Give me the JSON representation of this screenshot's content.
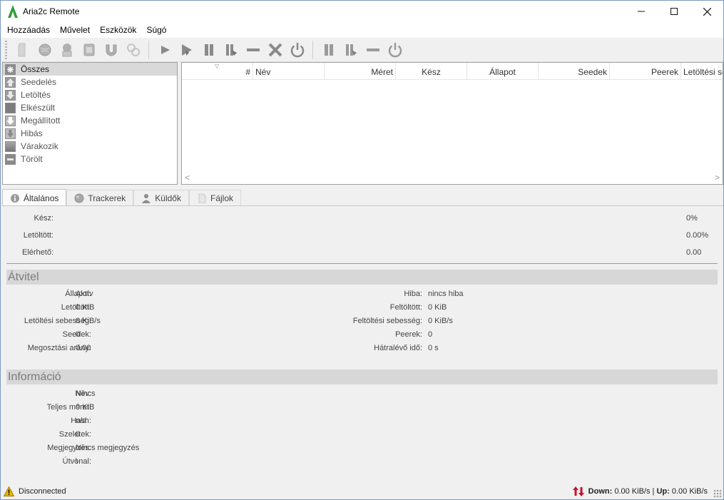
{
  "window": {
    "title": "Aria2c Remote"
  },
  "menu": [
    "Hozzáadás",
    "Művelet",
    "Eszközök",
    "Súgó"
  ],
  "filters": [
    {
      "label": "Összes",
      "icon": "asterisk-icon",
      "active": true
    },
    {
      "label": "Seedelés",
      "icon": "upload-arrow-icon"
    },
    {
      "label": "Letöltés",
      "icon": "download-arrow-icon"
    },
    {
      "label": "Elkészült",
      "icon": "completed-icon"
    },
    {
      "label": "Megállított",
      "icon": "stopped-icon"
    },
    {
      "label": "Hibás",
      "icon": "error-icon"
    },
    {
      "label": "Várakozik",
      "icon": "waiting-icon"
    },
    {
      "label": "Törölt",
      "icon": "removed-icon"
    }
  ],
  "table": {
    "columns": [
      "#",
      "Név",
      "Méret",
      "Kész",
      "Állapot",
      "Seedek",
      "Peerek",
      "Letöltési se"
    ]
  },
  "tabs": [
    {
      "label": "Általános",
      "icon": "info-icon"
    },
    {
      "label": "Trackerek",
      "icon": "globe-icon"
    },
    {
      "label": "Küldők",
      "icon": "user-icon"
    },
    {
      "label": "Fájlok",
      "icon": "file-icon"
    }
  ],
  "general": {
    "done_label": "Kész:",
    "done_value": "0%",
    "downloaded_label": "Letöltött:",
    "downloaded_value": "0.00%",
    "available_label": "Elérhető:",
    "available_value": "0.00"
  },
  "transfer": {
    "title": "Átvitel",
    "left": [
      {
        "label": "Állapot:",
        "value": "Aktív"
      },
      {
        "label": "Letöltött:",
        "value": "0 KiB"
      },
      {
        "label": "Letöltési sebesség:",
        "value": "0 KiB/s"
      },
      {
        "label": "Seedek:",
        "value": "0"
      },
      {
        "label": "Megosztási arány:",
        "value": "0.00"
      }
    ],
    "right": [
      {
        "label": "Hiba:",
        "value": "nincs hiba"
      },
      {
        "label": "Feltöltött:",
        "value": "0 KiB"
      },
      {
        "label": "Feltöltési sebesség:",
        "value": "0 KiB/s"
      },
      {
        "label": "Peerek:",
        "value": "0"
      },
      {
        "label": "Hátralévő idő:",
        "value": "0 s"
      }
    ]
  },
  "info": {
    "title": "Információ",
    "rows": [
      {
        "label": "Név:",
        "value": "Nincs"
      },
      {
        "label": "Teljes méret:",
        "value": "0 KiB"
      },
      {
        "label": "Hash:",
        "value": "n/a"
      },
      {
        "label": "Szeletek:",
        "value": "0"
      },
      {
        "label": "Megjegyzés:",
        "value": "Nincs megjegyzés"
      },
      {
        "label": "Útvonal:",
        "value": "\\"
      }
    ]
  },
  "status": {
    "connection": "Disconnected",
    "down_label": "Down:",
    "down_value": "0.00 KiB/s",
    "separator": "|",
    "up_label": "Up:",
    "up_value": "0.00 KiB/s"
  },
  "colors": {
    "accent_logo": "#2e9e3a",
    "warning": "#e8b400",
    "speed_icon": "#c8102e"
  }
}
